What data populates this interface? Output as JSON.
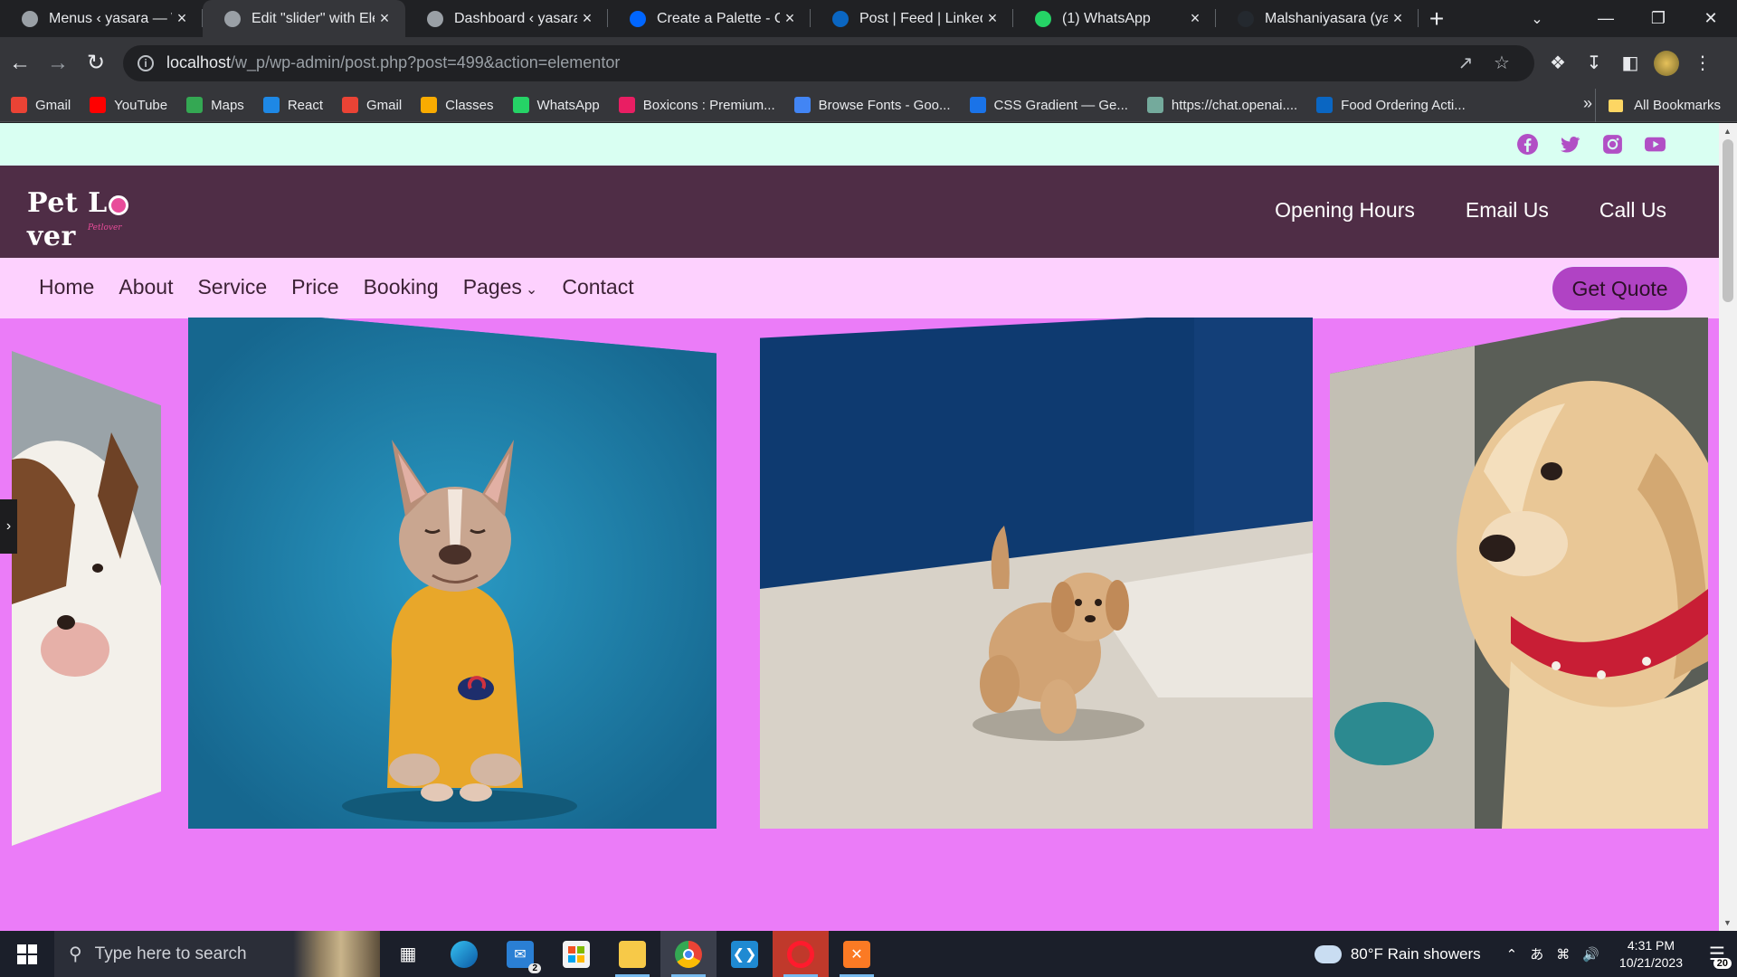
{
  "browser": {
    "tabs": [
      {
        "title": "Menus ‹ yasara — WordPress",
        "favicon": "globe-icon",
        "color": "#9aa0a6"
      },
      {
        "title": "Edit \"slider\" with Elementor",
        "favicon": "globe-icon",
        "color": "#9aa0a6",
        "active": true
      },
      {
        "title": "Dashboard ‹ yasara — WordPress",
        "favicon": "globe-icon",
        "color": "#9aa0a6"
      },
      {
        "title": "Create a Palette - Coolors",
        "favicon": "coolors-icon",
        "color": "#0066ff"
      },
      {
        "title": "Post | Feed | LinkedIn",
        "favicon": "linkedin-icon",
        "color": "#0a66c2"
      },
      {
        "title": "(1) WhatsApp",
        "favicon": "whatsapp-icon",
        "color": "#25d366"
      },
      {
        "title": "Malshaniyasara (yasara)",
        "favicon": "github-icon",
        "color": "#24292f"
      }
    ],
    "url_host": "localhost",
    "url_path": "/w_p/wp-admin/post.php?post=499&action=elementor",
    "bookmarks": [
      {
        "label": "Gmail",
        "icon": "gmail-icon",
        "color": "#ea4335"
      },
      {
        "label": "YouTube",
        "icon": "youtube-icon",
        "color": "#ff0000"
      },
      {
        "label": "Maps",
        "icon": "maps-icon",
        "color": "#34a853"
      },
      {
        "label": "React",
        "icon": "react-icon",
        "color": "#1e88e5"
      },
      {
        "label": "Gmail",
        "icon": "gmail-icon",
        "color": "#ea4335"
      },
      {
        "label": "Classes",
        "icon": "classroom-icon",
        "color": "#f9ab00"
      },
      {
        "label": "WhatsApp",
        "icon": "whatsapp-icon",
        "color": "#25d366"
      },
      {
        "label": "Boxicons : Premium...",
        "icon": "boxicons-icon",
        "color": "#e91e63"
      },
      {
        "label": "Browse Fonts - Goo...",
        "icon": "google-fonts-icon",
        "color": "#4285f4"
      },
      {
        "label": "CSS Gradient — Ge...",
        "icon": "css-gradient-icon",
        "color": "#1a73e8"
      },
      {
        "label": "https://chat.openai....",
        "icon": "openai-icon",
        "color": "#74aa9c"
      },
      {
        "label": "Food Ordering Acti...",
        "icon": "linkedin-icon",
        "color": "#0a66c2"
      }
    ],
    "all_bookmarks": "All Bookmarks"
  },
  "site": {
    "logo_text_1": "Pet L",
    "logo_text_2": "ver",
    "logo_sub": "Petlover",
    "header_links": [
      "Opening Hours",
      "Email Us",
      "Call Us"
    ],
    "menu": [
      "Home",
      "About",
      "Service",
      "Price",
      "Booking",
      "Pages",
      "Contact"
    ],
    "cta": "Get Quote",
    "socials": [
      {
        "name": "facebook-icon",
        "color": "#b14fc5"
      },
      {
        "name": "twitter-icon",
        "color": "#b14fc5"
      },
      {
        "name": "instagram-icon",
        "color": "#b14fc5"
      },
      {
        "name": "youtube-icon",
        "color": "#b14fc5"
      }
    ],
    "colors": {
      "topbar": "#d9fff2",
      "header": "#4f2d46",
      "navbar": "#fdd1fe",
      "hero": "#eb7cf8",
      "accent": "#b043c4"
    }
  },
  "taskbar": {
    "search_placeholder": "Type here to search",
    "weather": "80°F  Rain showers",
    "time": "4:31 PM",
    "date": "10/21/2023",
    "notifications": "20",
    "mail_badge": "2"
  }
}
